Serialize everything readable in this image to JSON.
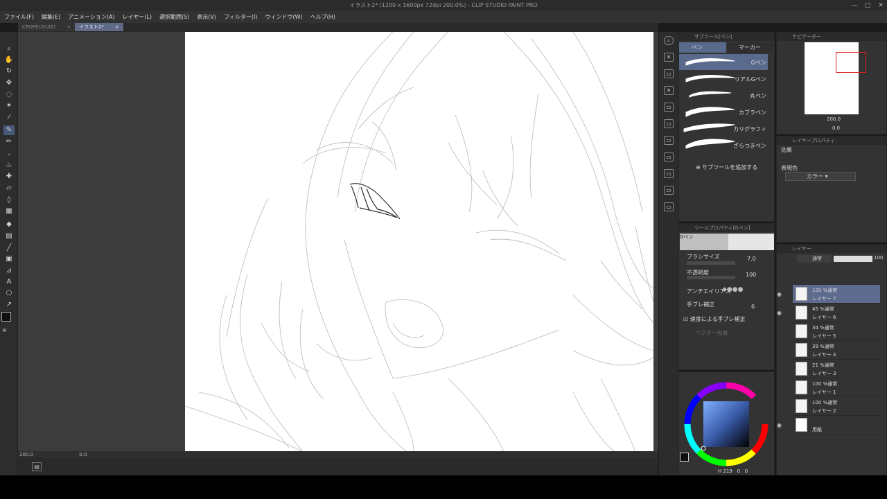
{
  "app": {
    "title": "イラスト2* (1200 x 1600px 72dpi 200.0%) - CLIP STUDIO PAINT PRO"
  },
  "window_controls": [
    "—",
    "□",
    "✕"
  ],
  "menu": [
    "ファイル(F)",
    "編集(E)",
    "アニメーション(A)",
    "レイヤー(L)",
    "選択範囲(S)",
    "表示(V)",
    "フィルター(I)",
    "ウィンドウ(W)",
    "ヘルプ(H)"
  ],
  "tabs": [
    {
      "label": "CRUPEUSU(E)",
      "close": "×"
    },
    {
      "label": "イラスト2*",
      "close": "×"
    }
  ],
  "tools": [
    "zoom-icon",
    "hand-icon",
    "rotate-icon",
    "move-icon",
    "lasso-select-icon",
    "magic-wand-icon",
    "eyedropper-icon",
    "pen-icon",
    "pencil-icon",
    "brush-icon",
    "airbrush-icon",
    "decoration-icon",
    "eraser-icon",
    "blend-icon",
    "fill-icon",
    "gradient-icon",
    "figure-icon",
    "frame-icon",
    "ruler-icon",
    "text-icon",
    "balloon-icon",
    "correction-icon",
    "color-swatch-icon"
  ],
  "status": {
    "zoom": "200.0",
    "angle": "0.0"
  },
  "subtool": {
    "panel_title": "サブツール[ペン]",
    "tab_pen": "ペン",
    "tab_marker": "マーカー",
    "brushes": [
      "Gペン",
      "リアルGペン",
      "丸ペン",
      "カブラペン",
      "カリグラフィ",
      "ざらつきペン"
    ],
    "add_label": "サブツールを追加する"
  },
  "toolprop": {
    "panel_title": "ツールプロパティ[Gペン]",
    "brush_name": "Gペン",
    "size_label": "ブラシサイズ",
    "size_value": "7.0",
    "opacity_label": "不透明度",
    "opacity_value": "100",
    "aa_label": "アンチエイリアス",
    "stab_label": "手ブレ補正",
    "stab_value": "6",
    "speed_stab_label": "速度による手ブレ補正",
    "vector_label": "ベクター吸着"
  },
  "color": {
    "h": "219",
    "s": "0",
    "v": "0",
    "main": "#101010"
  },
  "navigator": {
    "title": "ナビゲーター",
    "zoom": "200.0",
    "angle": "0.0"
  },
  "layerprop": {
    "title": "レイヤープロパティ",
    "effect_label": "効果",
    "expr_label": "表現色",
    "expr_value": "カラー"
  },
  "layers": {
    "title": "レイヤー",
    "blend_mode": "通常",
    "opacity": "100",
    "items": [
      {
        "info": "100 %通常",
        "name": "レイヤー 7",
        "selected": true
      },
      {
        "info": "45 %通常",
        "name": "レイヤー 6"
      },
      {
        "info": "34 %通常",
        "name": "レイヤー 5"
      },
      {
        "info": "39 %通常",
        "name": "レイヤー 4"
      },
      {
        "info": "21 %通常",
        "name": "レイヤー 3"
      },
      {
        "info": "100 %通常",
        "name": "レイヤー 1"
      },
      {
        "info": "100 %通常",
        "name": "レイヤー 2"
      },
      {
        "info": "",
        "name": "用紙"
      }
    ]
  }
}
